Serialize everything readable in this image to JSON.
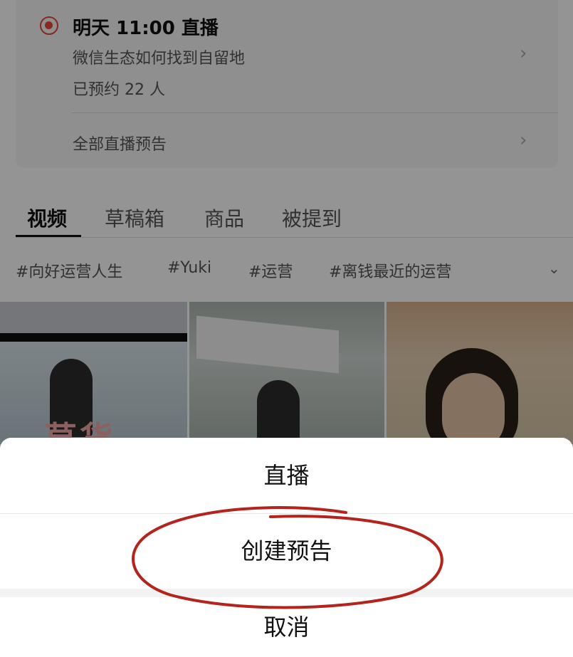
{
  "live_preview": {
    "time": "明天 11:00 直播",
    "title": "微信生态如何找到自留地",
    "booked": "已预约 22 人",
    "all_previews": "全部直播预告",
    "chevron_icon": "chevron-right-icon",
    "dot_color": "#e8473a"
  },
  "tabs": [
    "视频",
    "草稿箱",
    "商品",
    "被提到"
  ],
  "topics": [
    "#向好运营人生",
    "#Yuki",
    "#运营",
    "#离钱最近的运营"
  ],
  "topic_expand_icon": "chevron-down-icon",
  "thumbnail_text": "草货",
  "action_sheet": {
    "live": "直播",
    "create_preview": "创建预告",
    "cancel": "取消",
    "annotation_color": "#b5241c"
  }
}
